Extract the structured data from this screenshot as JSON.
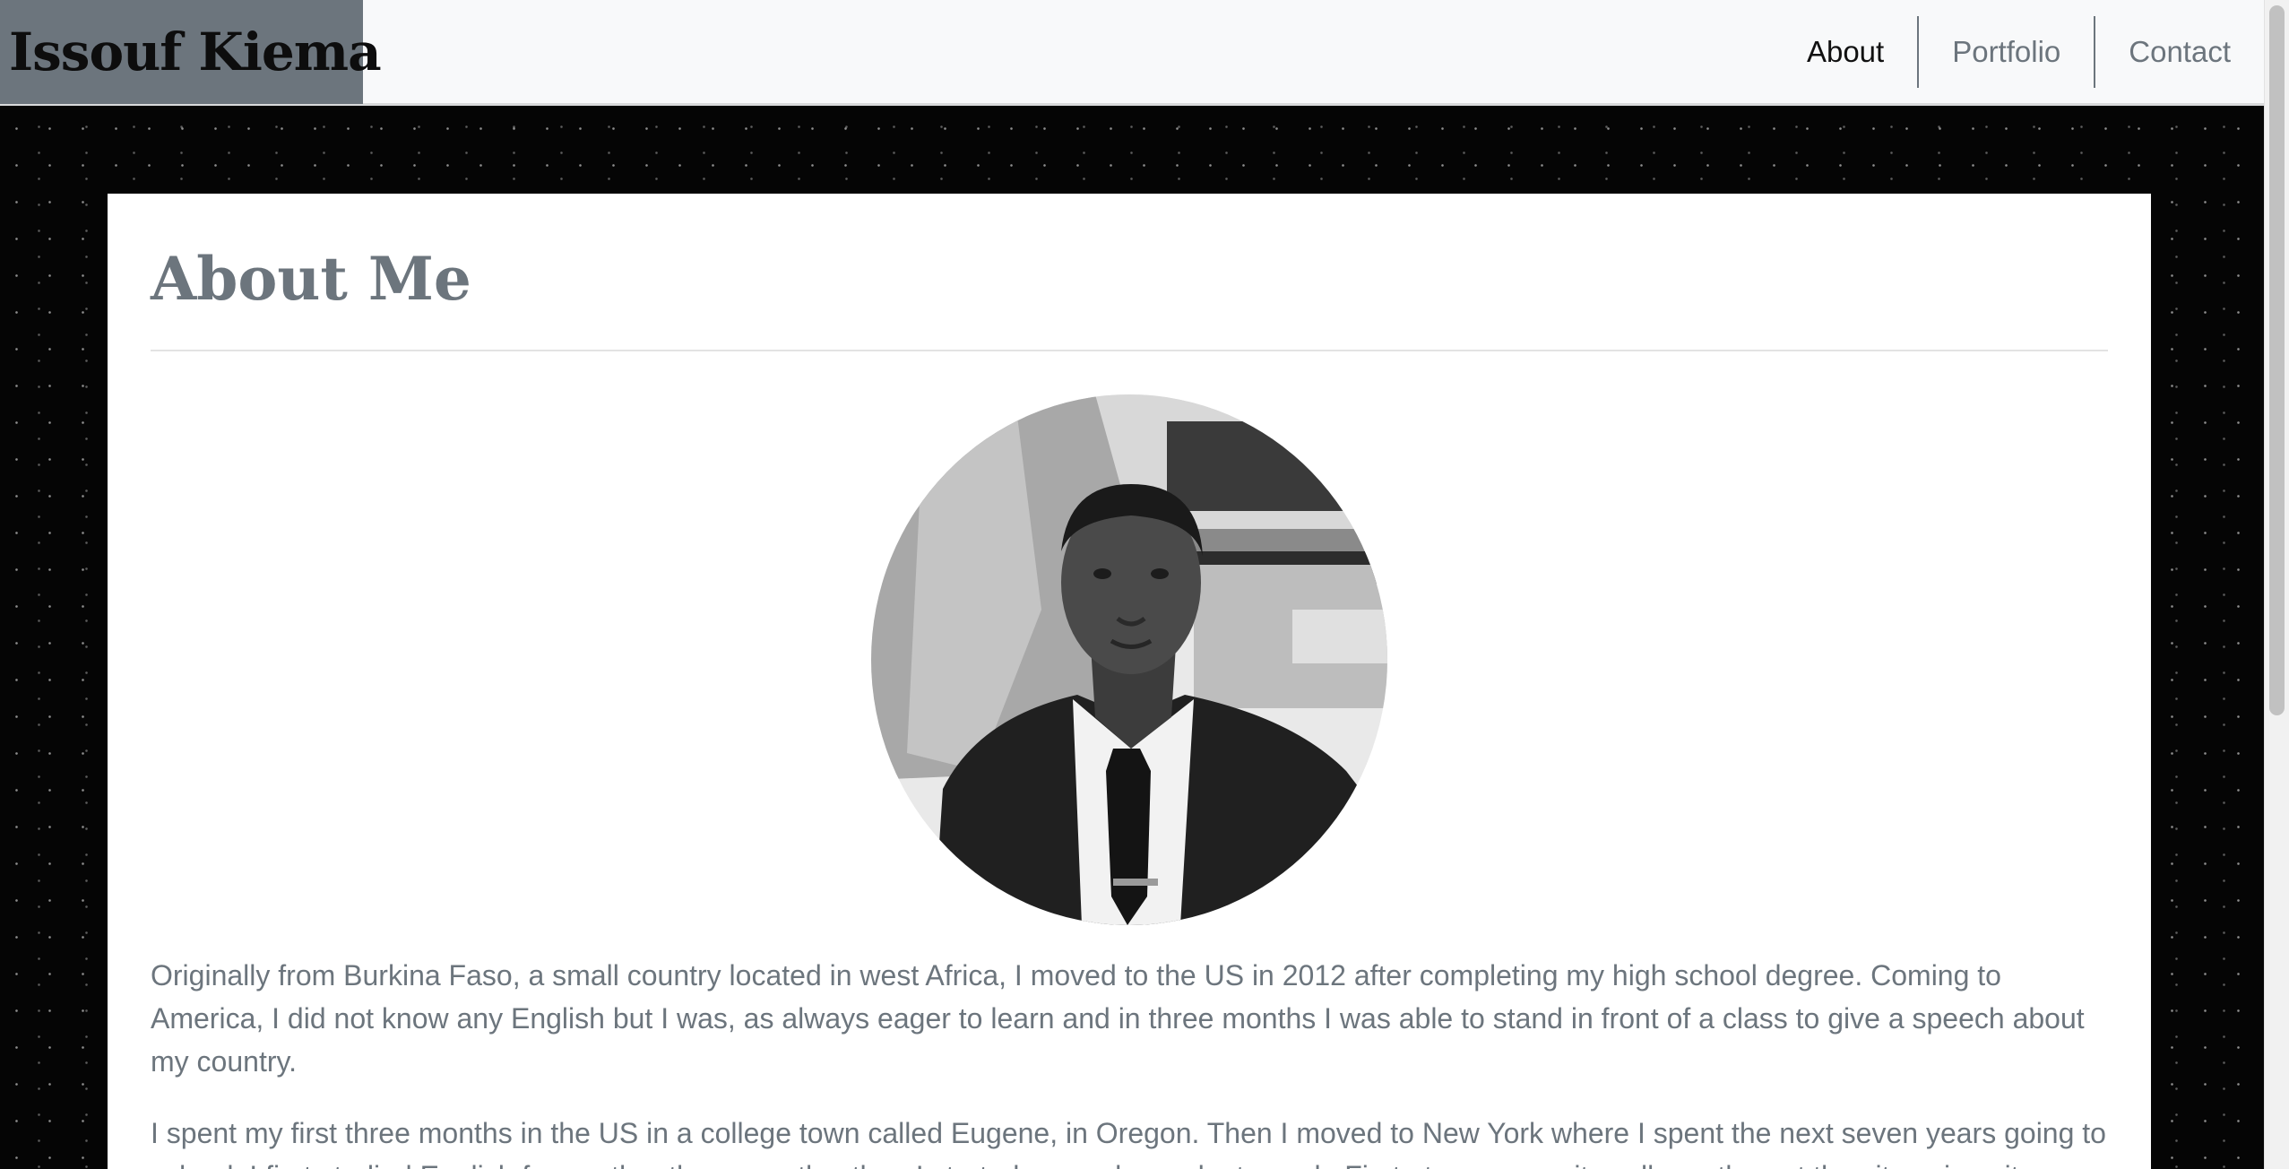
{
  "navbar": {
    "brand": "Issouf Kiema",
    "links": [
      {
        "label": "About",
        "active": true
      },
      {
        "label": "Portfolio",
        "active": false
      },
      {
        "label": "Contact",
        "active": false
      }
    ]
  },
  "main": {
    "title": "About Me",
    "paragraphs": [
      "Originally from Burkina Faso, a small country located in west Africa, I moved to the US in 2012 after completing my high school degree. Coming to America, I did not know any English but I was, as always eager to learn and in three months I was able to stand in front of a class to give a speech about my country.",
      "I spent my first three months in the US in a college town called Eugene, in Oregon. Then I moved to New York where I spent the next seven years going to school. I first studied English for another three months, then I started my undergraduate work. First at a community college, then at the city university"
    ]
  },
  "colors": {
    "brand_bg": "#6c757d",
    "navbar_bg": "#f8f9fa",
    "muted_text": "#6c757d",
    "page_bg": "#050505"
  },
  "icons": {
    "profile_photo": "portrait-photo"
  }
}
